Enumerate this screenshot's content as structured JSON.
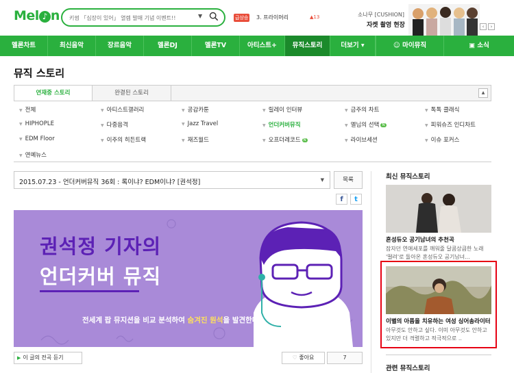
{
  "header": {
    "logo": "Mel",
    "logo_o": "On",
    "search_placeholder": "키썸 「심장이 있어」 열렘 발매 기념 이벤트!!",
    "search_dropdown": "▼",
    "trend_badge": "급상승",
    "trend_text": "3.  프라이머리",
    "trend_count": "▲13",
    "promo_sub": "소나무 [CUSHION]",
    "promo_title": "자켓 촬영 현장",
    "promo_prev": "‹",
    "promo_next": "›"
  },
  "gnb": {
    "items": [
      "멜론차트",
      "최신음악",
      "장르음악",
      "멜론DJ",
      "멜론TV",
      "아티스트+",
      "뮤직스토리",
      "더보기 ▾"
    ],
    "my_music": "마이뮤직",
    "social": "소식"
  },
  "page": {
    "title": "뮤직 스토리",
    "tabs": [
      "연재중 스토리",
      "완결된 스토리"
    ],
    "tab_toggle": "▲"
  },
  "categories": {
    "row1": [
      "전체",
      "아티스트갤러리",
      "공감카툰",
      "릴레이 인터뷰",
      "금주의 차트",
      "톡톡 클래식"
    ],
    "row2": [
      "HIPHOPLE",
      "다중음격",
      "Jazz Travel",
      "언더커버뮤직",
      "멜님의 선택",
      "피워슈즈 인디차트"
    ],
    "row3": [
      "EDM Floor",
      "이주의 히든트랙",
      "재즈월드",
      "오프더레코드",
      "라이브세션",
      "이슈 포커스"
    ],
    "row4": [
      "연예뉴스"
    ],
    "new_label": "N"
  },
  "story": {
    "selected": "2015.07.23 - 언더커버뮤직 36회 : 록이냐? EDM이냐? [권석정]",
    "list_button": "목록",
    "share_fb": "f",
    "share_tw": "t",
    "banner_line1": "권석정 기자의",
    "banner_line2": "언더커버 뮤직",
    "banner_sub_a": "전세계 팝 뮤지션을 비교 분석하여 ",
    "banner_sub_hl": "숨겨진 원석",
    "banner_sub_b": "을 발견한다!",
    "listen_button": "이 글의 전곡 듣기",
    "like_button": "좋아요",
    "like_count": "7"
  },
  "aside": {
    "latest_title": "최신 뮤직스토리",
    "cards": [
      {
        "title": "혼성듀오 공기남녀의 추천곡",
        "desc": "잠자던 연애세포를 깨워줄 달콤상큼한 노래 '떨려'로 돌아온 혼성듀오 공기남녀..."
      },
      {
        "title": "이별의 아픔을 치유하는 여성 싱어송라이터",
        "desc": "아무것도 안하고 싶다. 이미 아무것도 안하고 있지만 더 격렬하고 적극적으로 .."
      }
    ],
    "related_title": "관련 뮤직스토리"
  },
  "colors": {
    "brand_green": "#2ab03e",
    "gnb_active": "#1b8a2b",
    "banner_purple": "#a98ad8",
    "highlight_red": "#e60012"
  }
}
